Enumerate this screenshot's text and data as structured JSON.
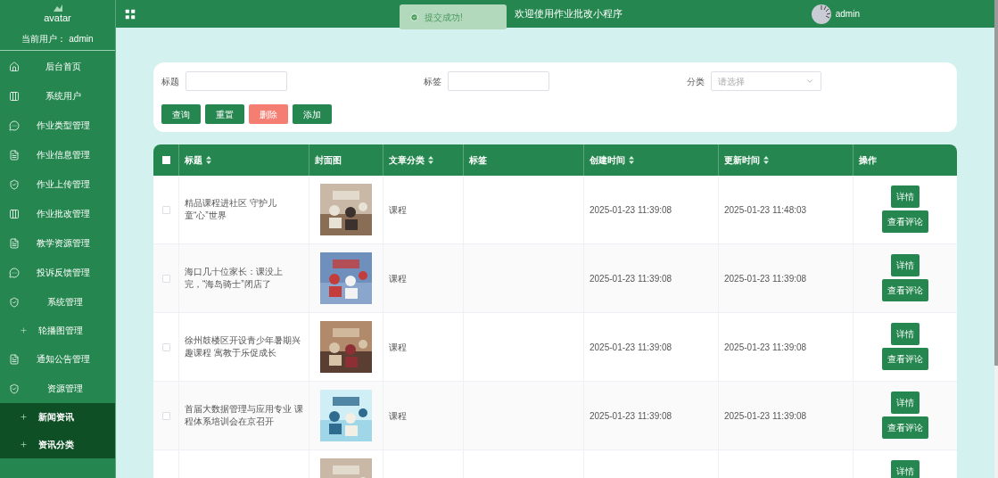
{
  "sidebar": {
    "avatar_alt": "avatar",
    "current_user": "当前用户： admin",
    "items": [
      {
        "label": "后台首页"
      },
      {
        "label": "系统用户"
      },
      {
        "label": "作业类型管理"
      },
      {
        "label": "作业信息管理"
      },
      {
        "label": "作业上传管理"
      },
      {
        "label": "作业批改管理"
      },
      {
        "label": "教学资源管理"
      },
      {
        "label": "投诉反馈管理"
      },
      {
        "label": "系统管理",
        "children": [
          {
            "label": "轮播图管理",
            "selected": false
          }
        ]
      },
      {
        "label": "通知公告管理"
      },
      {
        "label": "资源管理",
        "children": [
          {
            "label": "新闻资讯",
            "selected": true
          },
          {
            "label": "资讯分类",
            "selected": true
          }
        ]
      }
    ]
  },
  "header": {
    "title": "欢迎使用作业批改小程序",
    "user": "admin"
  },
  "toast": {
    "message": "提交成功!"
  },
  "search": {
    "fields": [
      {
        "label": "标题",
        "kind": "input"
      },
      {
        "label": "标签",
        "kind": "input"
      },
      {
        "label": "分类",
        "kind": "select",
        "placeholder": "请选择"
      }
    ],
    "buttons": [
      {
        "label": "查询",
        "kind": "primary"
      },
      {
        "label": "重置",
        "kind": "primary"
      },
      {
        "label": "删除",
        "kind": "danger"
      },
      {
        "label": "添加",
        "kind": "primary"
      }
    ]
  },
  "table": {
    "header_checked": false,
    "columns": [
      {
        "label": "标题",
        "sortable": true
      },
      {
        "label": "封面图",
        "sortable": false
      },
      {
        "label": "文章分类",
        "sortable": true
      },
      {
        "label": "标签",
        "sortable": false
      },
      {
        "label": "创建时间",
        "sortable": true
      },
      {
        "label": "更新时间",
        "sortable": true
      },
      {
        "label": "操作",
        "sortable": false
      }
    ],
    "rows": [
      {
        "checked": false,
        "title": "精品课程进社区 守护儿童“心”世界",
        "cover": {
          "kind": "picture"
        },
        "category": "课程",
        "created": "2025-01-23 11:39:08",
        "updated": "2025-01-23 11:48:03",
        "actions": [
          "详情",
          "查看评论"
        ]
      },
      {
        "checked": false,
        "title": "海口几十位家长：课没上完，“海岛骑士”闭店了",
        "cover": {
          "kind": "picture"
        },
        "category": "课程",
        "created": "2025-01-23 11:39:08",
        "updated": "2025-01-23 11:39:08",
        "actions": [
          "详情",
          "查看评论"
        ]
      },
      {
        "checked": false,
        "title": "徐州鼓楼区开设青少年暑期兴趣课程 寓教于乐促成长",
        "cover": {
          "kind": "picture"
        },
        "category": "课程",
        "created": "2025-01-23 11:39:08",
        "updated": "2025-01-23 11:39:08",
        "actions": [
          "详情",
          "查看评论"
        ]
      },
      {
        "checked": false,
        "title": "首届大数据管理与应用专业 课程体系培训会在京召开",
        "cover": {
          "kind": "picture"
        },
        "category": "课程",
        "created": "2025-01-23 11:39:08",
        "updated": "2025-01-23 11:39:08",
        "actions": [
          "详情",
          "查看评论"
        ]
      },
      {
        "cover": {
          "kind": "picture"
        },
        "actions": [
          "详情"
        ]
      }
    ]
  }
}
